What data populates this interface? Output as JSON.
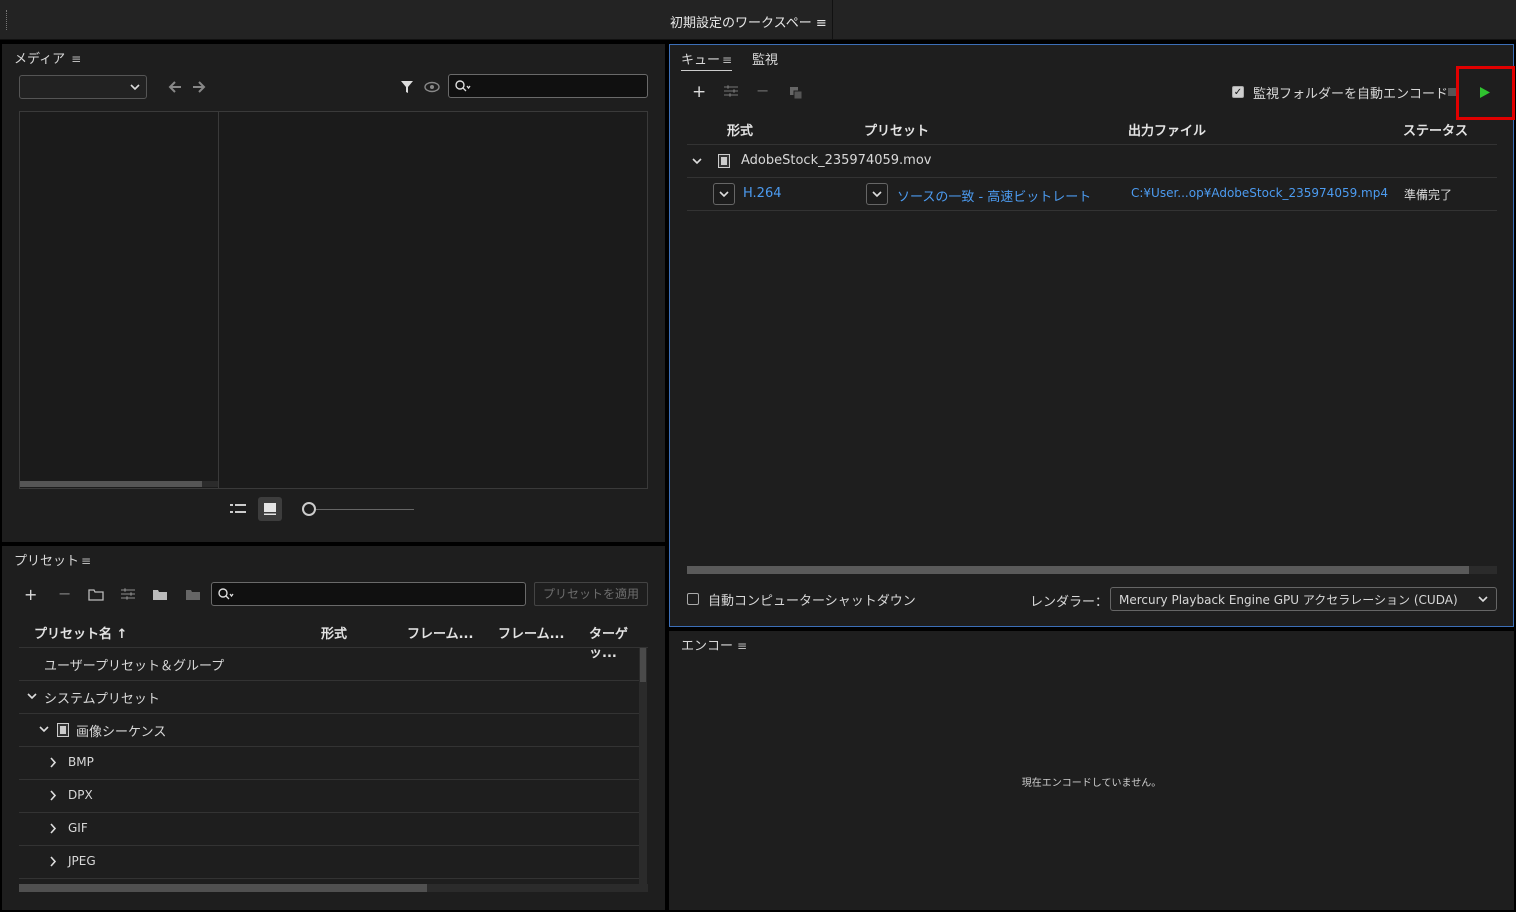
{
  "workspace": {
    "title": "初期設定のワークスペー",
    "menu_icon": "≡"
  },
  "media": {
    "title": "メディア",
    "menu_icon": "≡",
    "dropdown_value": "",
    "search_placeholder": ""
  },
  "queue": {
    "tabs": [
      {
        "label": "キュー",
        "active": true
      },
      {
        "label": "監視",
        "active": false
      }
    ],
    "menu_icon": "≡",
    "auto_encode_label": "監視フォルダーを自動エンコード",
    "auto_encode_checked": true,
    "columns": {
      "format": "形式",
      "preset": "プリセット",
      "output": "出力ファイル",
      "status": "ステータス"
    },
    "source_file": "AdobeStock_235974059.mov",
    "item": {
      "format": "H.264",
      "preset": "ソースの一致 - 高速ビットレート",
      "output": "C:¥User...op¥AdobeStock_235974059.mp4",
      "status": "準備完了"
    },
    "shutdown_label": "自動コンピューターシャットダウン",
    "renderer_label": "レンダラー：",
    "renderer_value": "Mercury Playback Engine GPU アクセラレーション (CUDA)",
    "play_color": "#2fc22f"
  },
  "presets": {
    "title": "プリセット",
    "menu_icon": "≡",
    "apply_button": "プリセットを適用",
    "search_placeholder": "",
    "columns": {
      "name": "プリセット名",
      "format": "形式",
      "frame1": "フレーム...",
      "frame2": "フレーム...",
      "target": "ターゲッ..."
    },
    "rows": [
      {
        "label": "ユーザープリセット＆グループ",
        "indent": 0,
        "chevron": ""
      },
      {
        "label": "システムプリセット",
        "indent": 1,
        "chevron": "down"
      },
      {
        "label": "画像シーケンス",
        "indent": 2,
        "chevron": "down"
      },
      {
        "label": "BMP",
        "indent": 3,
        "chevron": "right"
      },
      {
        "label": "DPX",
        "indent": 3,
        "chevron": "right"
      },
      {
        "label": "GIF",
        "indent": 3,
        "chevron": "right"
      },
      {
        "label": "JPEG",
        "indent": 3,
        "chevron": "right"
      }
    ]
  },
  "encoder": {
    "title": "エンコー",
    "menu_icon": "≡",
    "status_message": "現在エンコードしていません。"
  },
  "colors": {
    "accent_blue": "#4c9bf0",
    "panel_border_active": "#3c6fb8",
    "highlight_red": "#e00000"
  }
}
